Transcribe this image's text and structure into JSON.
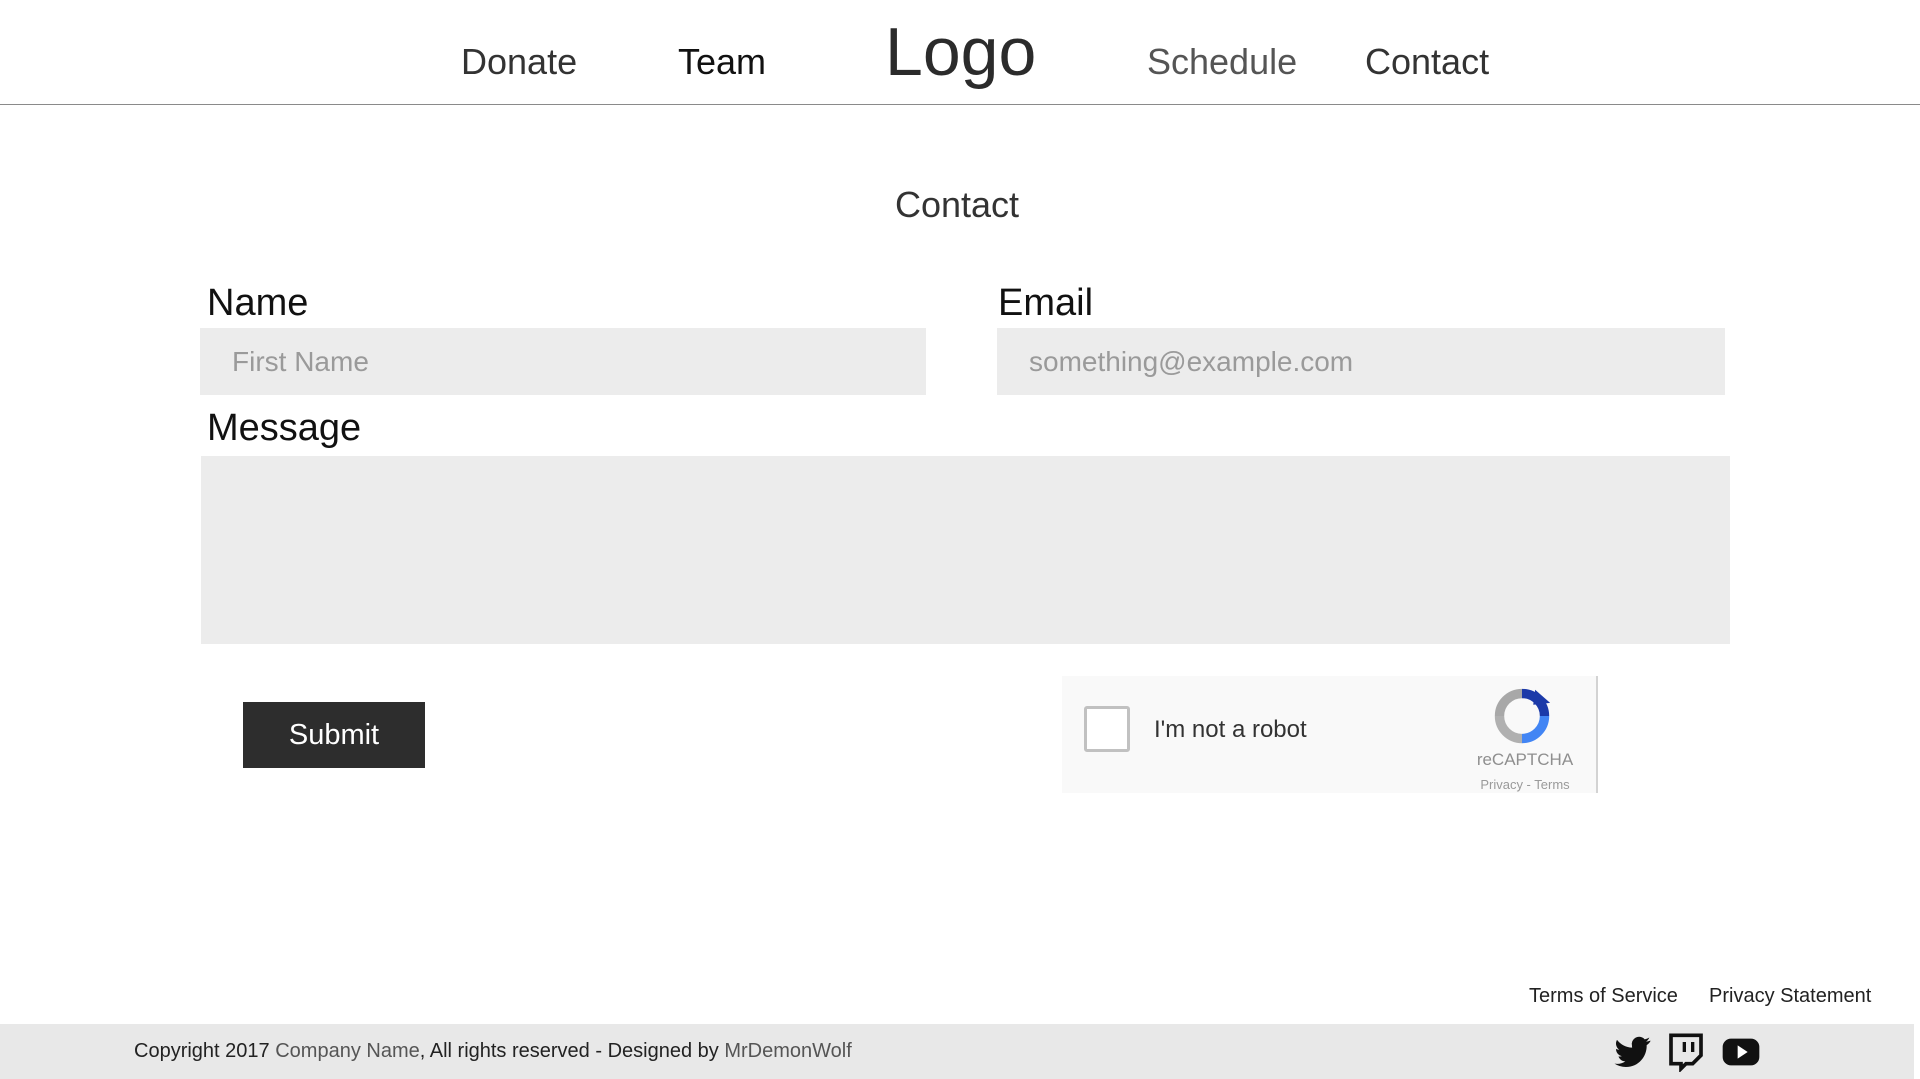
{
  "nav": {
    "donate": "Donate",
    "team": "Team",
    "logo": "Logo",
    "schedule": "Schedule",
    "contact": "Contact"
  },
  "main": {
    "title": "Contact",
    "name_label": "Name",
    "name_placeholder": "First Name",
    "email_label": "Email",
    "email_placeholder": "something@example.com",
    "message_label": "Message",
    "message_value": "",
    "submit_label": "Submit"
  },
  "recaptcha": {
    "label": "I'm not a robot",
    "brand": "reCAPTCHA",
    "links": "Privacy - Terms",
    "checked": false
  },
  "footer": {
    "terms": "Terms of Service",
    "privacy": "Privacy Statement",
    "copyright_prefix": "Copyright 2017",
    "company_name": "Company Name",
    "rights": ",  All rights reserved  - Designed by",
    "designer": "MrDemonWolf",
    "social": [
      "twitter-icon",
      "twitch-icon",
      "youtube-icon"
    ]
  },
  "colors": {
    "input_bg": "#ececec",
    "button_bg": "#2d2d2d",
    "footer_bg": "#e8e8e8"
  }
}
